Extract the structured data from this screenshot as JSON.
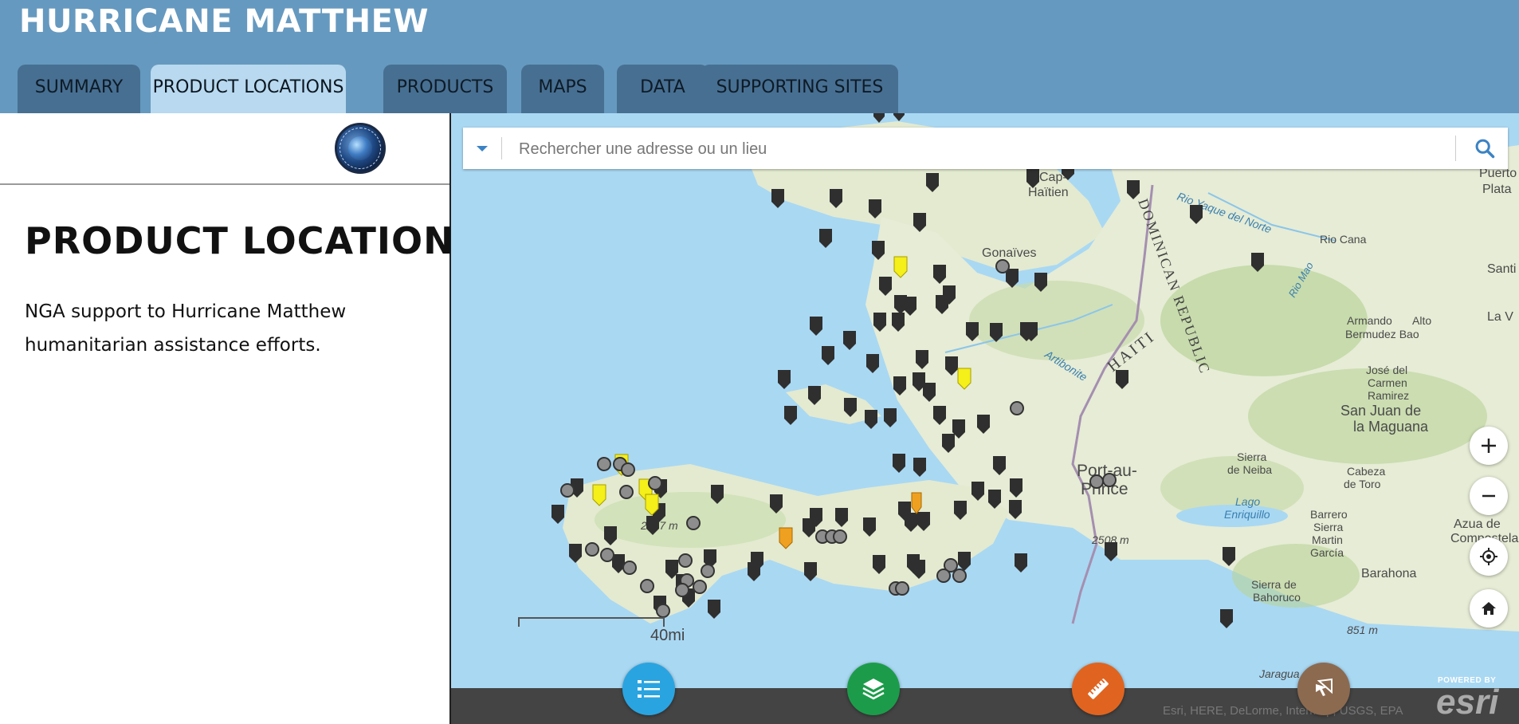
{
  "app": {
    "title": "HURRICANE MATTHEW"
  },
  "tabs": [
    {
      "label": "SUMMARY",
      "active": false
    },
    {
      "label": "PRODUCT LOCATIONS",
      "active": true
    },
    {
      "label": "PRODUCTS",
      "active": false
    },
    {
      "label": "MAPS",
      "active": false
    },
    {
      "label": "DATA",
      "active": false
    },
    {
      "label": "SUPPORTING SITES",
      "active": false
    }
  ],
  "panel": {
    "title": "PRODUCT LOCATIONS",
    "description": "NGA support to Hurricane Matthew humanitarian assistance efforts."
  },
  "map": {
    "search": {
      "placeholder": "Rechercher une adresse ou un lieu"
    },
    "labels": [
      "Cap-",
      "Haïtien",
      "Gonaïves",
      "Port-au-",
      "Prince",
      "HAITI",
      "DOMINICAN REPUBLIC",
      "Puerto",
      "Plata",
      "Santi",
      "La V",
      "Rio Cana",
      "Armando",
      "Alto",
      "Bermudez Bao",
      "José del",
      "Carmen",
      "Ramirez",
      "San Juan de",
      "la Maguana",
      "Sierra",
      "de Neiba",
      "Cabeza",
      "de Toro",
      "Lago",
      "Enriquillo",
      "Barrero",
      "Sierra",
      "Martin",
      "García",
      "Azua de",
      "Compostela",
      "Barahona",
      "Sierra de",
      "Bahoruco",
      "2508 m",
      "2347 m",
      "851 m",
      "Rio Yaque del Norte",
      "Rio Mao",
      "Artibonite",
      "Jaragua"
    ],
    "scale_label": "40mi",
    "attribution": "Esri, HERE, DeLorme, Intermap, USGS, EPA",
    "powered_by": "POWERED BY",
    "esri_logo": "esri"
  },
  "colors": {
    "header_bg": "#6699bf",
    "tab_bg": "#476f92",
    "tab_active_bg": "#b8d9ef",
    "water": "#a9d8f3",
    "land": "#e6ecd5",
    "marker_dark": "#2f2f2f",
    "marker_yellow": "#f5ef1a",
    "marker_orange": "#f0a020",
    "fab_legend": "#2aa4e0",
    "fab_layers": "#1c9c4a",
    "fab_measure": "#e0641f",
    "fab_share": "#8c6a50"
  }
}
